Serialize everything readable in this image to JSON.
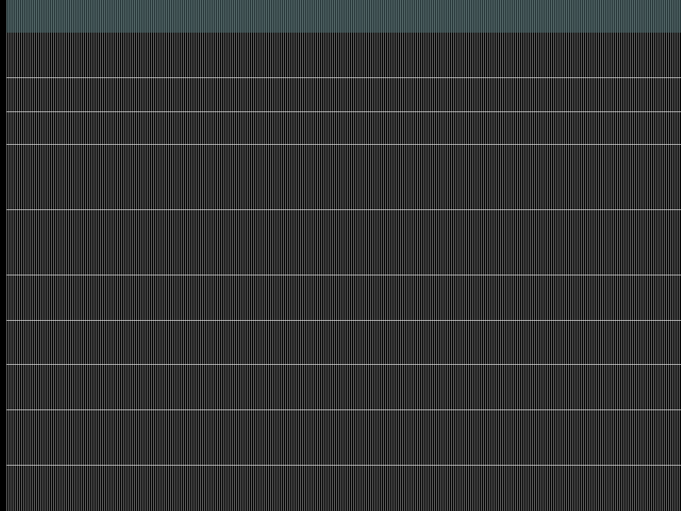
{
  "top_bar": {
    "status_text": ""
  },
  "rows": [
    {
      "lines": [
        ""
      ]
    },
    {
      "lines": [
        ""
      ]
    },
    {
      "lines": [
        ""
      ]
    },
    {
      "lines": [
        "",
        ""
      ]
    },
    {
      "lines": [
        "",
        ""
      ]
    },
    {
      "lines": [
        ""
      ]
    },
    {
      "lines": [
        ""
      ]
    },
    {
      "lines": [
        ""
      ]
    },
    {
      "lines": [
        ""
      ]
    },
    {
      "lines": [
        "",
        ""
      ]
    }
  ],
  "colors": {
    "top_bar": "#2c3c3e",
    "background": "#0a0a0a",
    "rule": "#fafafa",
    "left_rail": "#000000"
  }
}
